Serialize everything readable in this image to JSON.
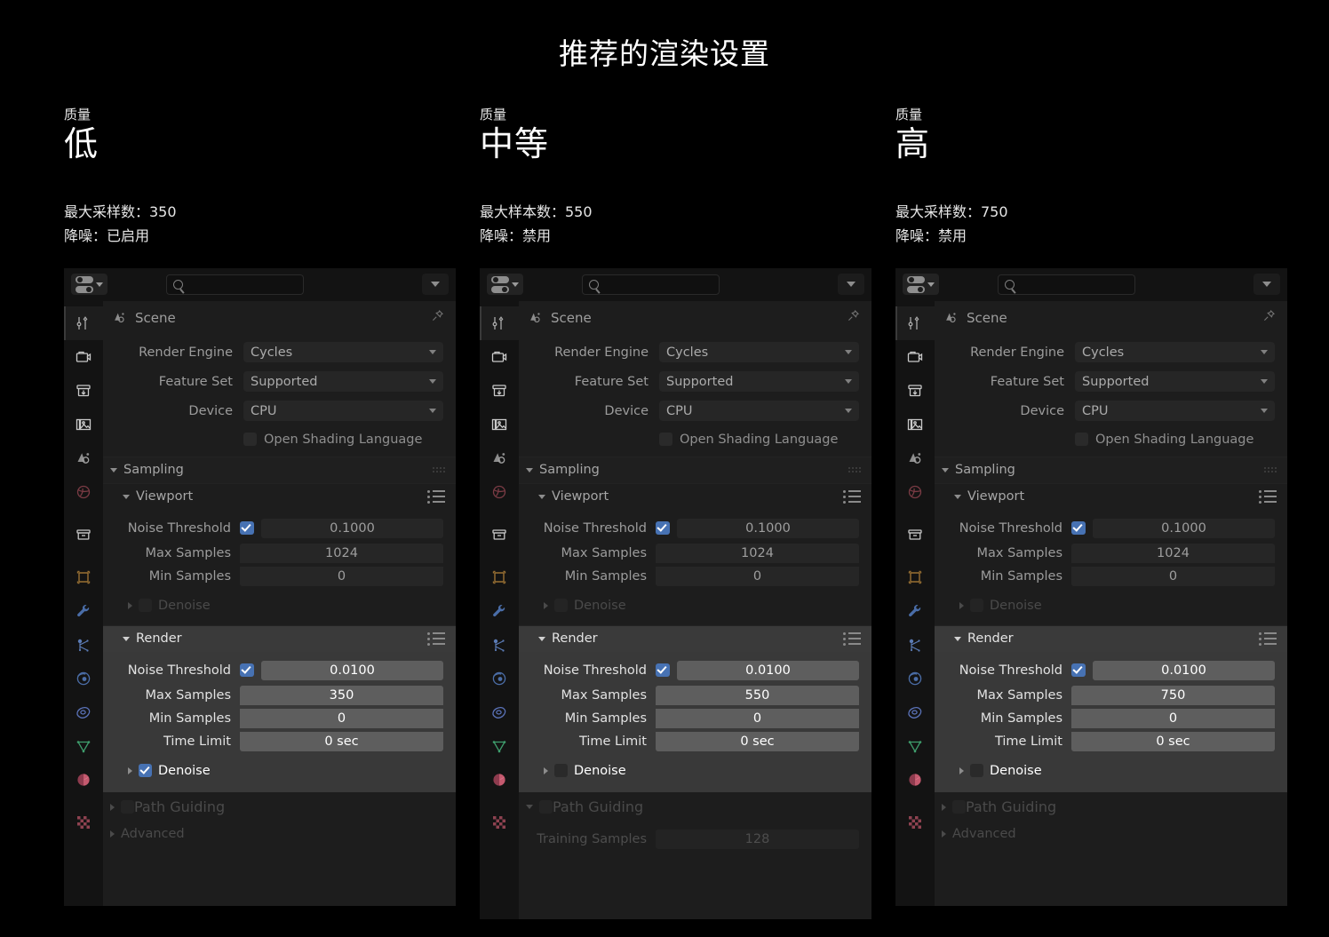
{
  "title": "推荐的渲染设置",
  "columns": [
    {
      "quality_label": "质量",
      "quality_value": "低",
      "meta": [
        "最大采样数：350",
        "降噪：已启用"
      ],
      "panel": {
        "breadcrumb": "Scene",
        "render_engine_label": "Render Engine",
        "render_engine_value": "Cycles",
        "feature_set_label": "Feature Set",
        "feature_set_value": "Supported",
        "device_label": "Device",
        "device_value": "CPU",
        "osl_label": "Open Shading Language",
        "sampling_label": "Sampling",
        "viewport_label": "Viewport",
        "viewport": {
          "noise_threshold_label": "Noise Threshold",
          "noise_threshold_value": "0.1000",
          "max_samples_label": "Max Samples",
          "max_samples_value": "1024",
          "min_samples_label": "Min Samples",
          "min_samples_value": "0",
          "denoise_label": "Denoise"
        },
        "render_label": "Render",
        "render": {
          "noise_threshold_label": "Noise Threshold",
          "noise_threshold_value": "0.0100",
          "max_samples_label": "Max Samples",
          "max_samples_value": "350",
          "min_samples_label": "Min Samples",
          "min_samples_value": "0",
          "time_limit_label": "Time Limit",
          "time_limit_value": "0 sec",
          "denoise_label": "Denoise"
        },
        "path_guiding_label": "Path Guiding",
        "advanced_label": "Advanced"
      }
    },
    {
      "quality_label": "质量",
      "quality_value": "中等",
      "meta": [
        "最大样本数：550",
        "降噪：禁用"
      ],
      "panel": {
        "breadcrumb": "Scene",
        "render_engine_label": "Render Engine",
        "render_engine_value": "Cycles",
        "feature_set_label": "Feature Set",
        "feature_set_value": "Supported",
        "device_label": "Device",
        "device_value": "CPU",
        "osl_label": "Open Shading Language",
        "sampling_label": "Sampling",
        "viewport_label": "Viewport",
        "viewport": {
          "noise_threshold_label": "Noise Threshold",
          "noise_threshold_value": "0.1000",
          "max_samples_label": "Max Samples",
          "max_samples_value": "1024",
          "min_samples_label": "Min Samples",
          "min_samples_value": "0",
          "denoise_label": "Denoise"
        },
        "render_label": "Render",
        "render": {
          "noise_threshold_label": "Noise Threshold",
          "noise_threshold_value": "0.0100",
          "max_samples_label": "Max Samples",
          "max_samples_value": "550",
          "min_samples_label": "Min Samples",
          "min_samples_value": "0",
          "time_limit_label": "Time Limit",
          "time_limit_value": "0 sec",
          "denoise_label": "Denoise"
        },
        "path_guiding_label": "Path Guiding",
        "training_samples_label": "Training Samples",
        "training_samples_value": "128"
      }
    },
    {
      "quality_label": "质量",
      "quality_value": "高",
      "meta": [
        "最大采样数：750",
        "降噪：禁用"
      ],
      "panel": {
        "breadcrumb": "Scene",
        "render_engine_label": "Render Engine",
        "render_engine_value": "Cycles",
        "feature_set_label": "Feature Set",
        "feature_set_value": "Supported",
        "device_label": "Device",
        "device_value": "CPU",
        "osl_label": "Open Shading Language",
        "sampling_label": "Sampling",
        "viewport_label": "Viewport",
        "viewport": {
          "noise_threshold_label": "Noise Threshold",
          "noise_threshold_value": "0.1000",
          "max_samples_label": "Max Samples",
          "max_samples_value": "1024",
          "min_samples_label": "Min Samples",
          "min_samples_value": "0",
          "denoise_label": "Denoise"
        },
        "render_label": "Render",
        "render": {
          "noise_threshold_label": "Noise Threshold",
          "noise_threshold_value": "0.0100",
          "max_samples_label": "Max Samples",
          "max_samples_value": "750",
          "min_samples_label": "Min Samples",
          "min_samples_value": "0",
          "time_limit_label": "Time Limit",
          "time_limit_value": "0 sec",
          "denoise_label": "Denoise"
        },
        "path_guiding_label": "Path Guiding",
        "advanced_label": "Advanced"
      }
    }
  ],
  "colors": {
    "background": "#000000",
    "panel": "#1d1d1d",
    "panel_header": "#131313",
    "highlight_panel": "#393939",
    "checkbox_blue": "#4772b3",
    "text": "#ffffff"
  }
}
